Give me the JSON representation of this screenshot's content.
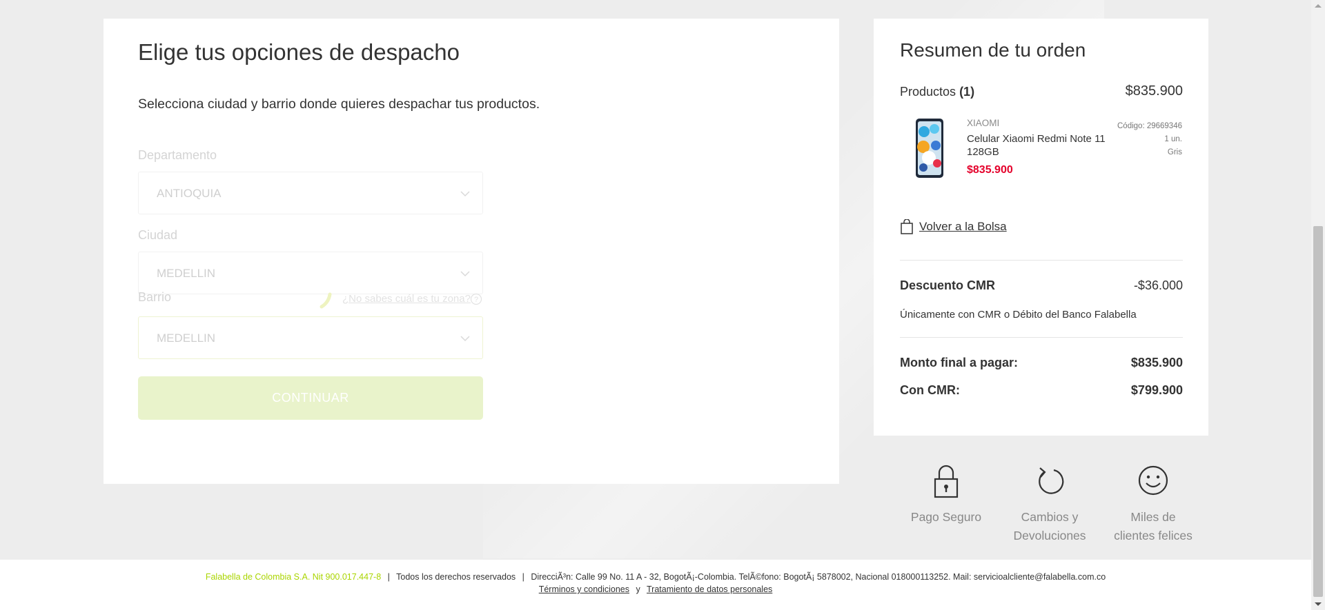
{
  "shipping": {
    "title": "Elige tus opciones de despacho",
    "subtitle": "Selecciona ciudad y barrio donde quieres despachar tus productos.",
    "department_label": "Departamento",
    "department_value": "ANTIOQUIA",
    "city_label": "Ciudad",
    "city_value": "MEDELLIN",
    "neighborhood_label": "Barrio",
    "neighborhood_value": "MEDELLIN",
    "zone_help_link": "¿No sabes cuál es tu zona?",
    "continue_label": "CONTINUAR"
  },
  "summary": {
    "title": "Resumen de tu orden",
    "products_label": "Productos",
    "products_count": "(1)",
    "products_total": "$835.900",
    "product": {
      "brand": "XIAOMI",
      "name": "Celular Xiaomi Redmi Note 11 128GB",
      "price": "$835.900",
      "code": "Código: 29669346",
      "quantity": "1 un.",
      "color": "Gris"
    },
    "back_to_bag": "Volver a la Bolsa",
    "discount_label": "Descuento CMR",
    "discount_value": "-$36.000",
    "discount_note": "Únicamente con CMR o Débito del Banco Falabella",
    "final_label": "Monto final a pagar:",
    "final_value": "$835.900",
    "cmr_label": "Con CMR:",
    "cmr_value": "$799.900"
  },
  "badges": [
    {
      "icon": "lock-icon",
      "line1": "Pago Seguro",
      "line2": ""
    },
    {
      "icon": "return-arrow-icon",
      "line1": "Cambios y",
      "line2": "Devoluciones"
    },
    {
      "icon": "smiley-icon",
      "line1": "Miles de",
      "line2": "clientes felices"
    }
  ],
  "footer": {
    "company": "Falabella de Colombia S.A. Nit 900.017.447-8",
    "separator": "|",
    "rights": "Todos los derechos reservados",
    "address": "DirecciÃ³n: Calle 99 No. 11 A - 32, BogotÃ¡-Colombia. TelÃ©fono: BogotÃ¡ 5878002, Nacional 018000113252. Mail: servicioalcliente@falabella.com.co",
    "terms": "Términos y condiciones",
    "and": "y",
    "privacy": "Tratamiento de datos personales"
  },
  "colors": {
    "accent_green": "#aad500",
    "button_disabled": "#e9f3cb",
    "price_red": "#e4002b"
  }
}
